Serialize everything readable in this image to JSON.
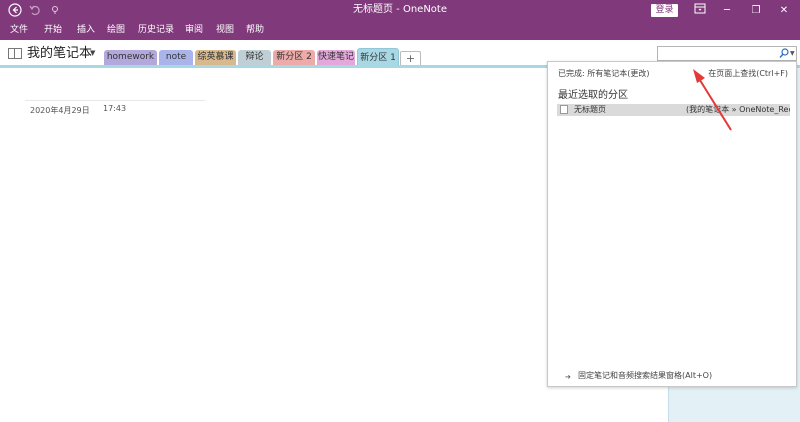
{
  "window": {
    "title": "无标题页 - OneNote",
    "login_label": "登录",
    "accent": "#80397b"
  },
  "quick_access": {
    "back_icon": "back-circle-icon",
    "undo_icon": "undo-icon",
    "customize_icon": "pin-down-icon"
  },
  "window_controls": {
    "ribbon_icon": "ribbon-display-icon",
    "minimize": "─",
    "maximize": "❐",
    "close": "✕"
  },
  "menu": {
    "items": [
      "文件",
      "开始",
      "插入",
      "绘图",
      "历史记录",
      "审阅",
      "视图",
      "帮助"
    ]
  },
  "notebook": {
    "name": "我的笔记本",
    "sections": [
      {
        "label": "homework",
        "color": "#b4a7dc"
      },
      {
        "label": "note",
        "color": "#a9b4ea"
      },
      {
        "label": "综英慕课",
        "color": "#d8b98e"
      },
      {
        "label": "辩论",
        "color": "#c0ced6"
      },
      {
        "label": "新分区 2",
        "color": "#ecaaa8"
      },
      {
        "label": "快速笔记",
        "color": "#e2a8da"
      },
      {
        "label": "新分区 1",
        "color": "#a8d8e4"
      }
    ],
    "add_section_label": "+"
  },
  "search": {
    "value": "",
    "placeholder": "",
    "icon": "search-icon",
    "scope_text": "已完成: 所有笔记本(更改)",
    "find_on_page_text": "在页面上查找(Ctrl+F)",
    "recent_title": "最近选取的分区",
    "results": [
      {
        "name": "无标题页",
        "path": "(我的笔记本 » OneNote_RecycleBin)"
      }
    ],
    "pin_text": "固定笔记和音频搜索结果窗格(Alt+O)"
  },
  "page": {
    "date": "2020年4月29日",
    "time": "17:43"
  },
  "annotation": {
    "arrow_color": "#e53935"
  }
}
